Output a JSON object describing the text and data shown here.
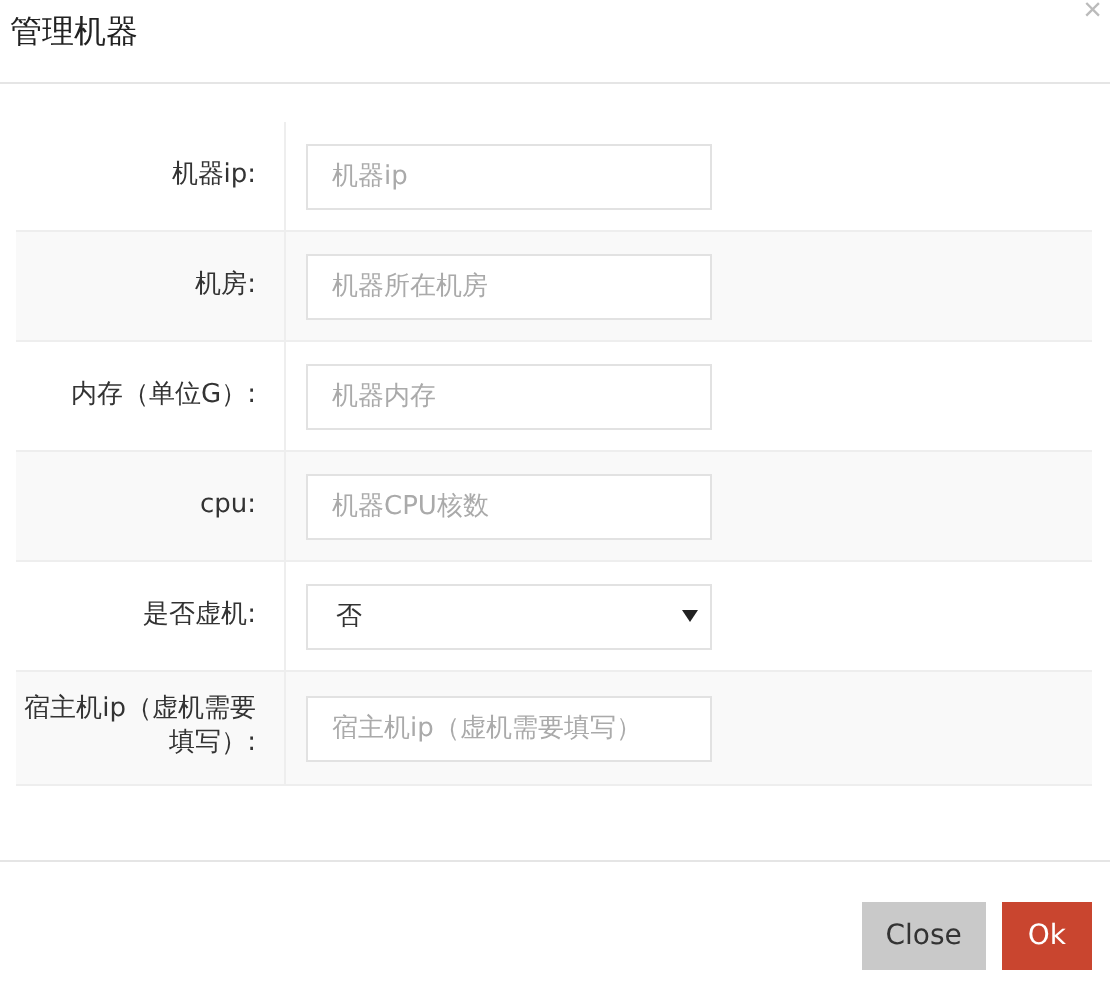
{
  "dialog": {
    "title": "管理机器",
    "close": "×"
  },
  "fields": [
    {
      "kind": "input",
      "label": "机器ip:",
      "placeholder": "机器ip"
    },
    {
      "kind": "input",
      "label": "机房:",
      "placeholder": "机器所在机房"
    },
    {
      "kind": "input",
      "label": "内存（单位G）:",
      "placeholder": "机器内存"
    },
    {
      "kind": "input",
      "label": "cpu:",
      "placeholder": "机器CPU核数"
    },
    {
      "kind": "select",
      "label": "是否虚机:",
      "value": "否"
    },
    {
      "kind": "input",
      "label": "宿主机ip（虚机需要填写）:",
      "placeholder": "宿主机ip（虚机需要填写）"
    }
  ],
  "buttons": [
    {
      "label": "Close",
      "kind": "default"
    },
    {
      "label": "Ok",
      "kind": "primary"
    }
  ]
}
